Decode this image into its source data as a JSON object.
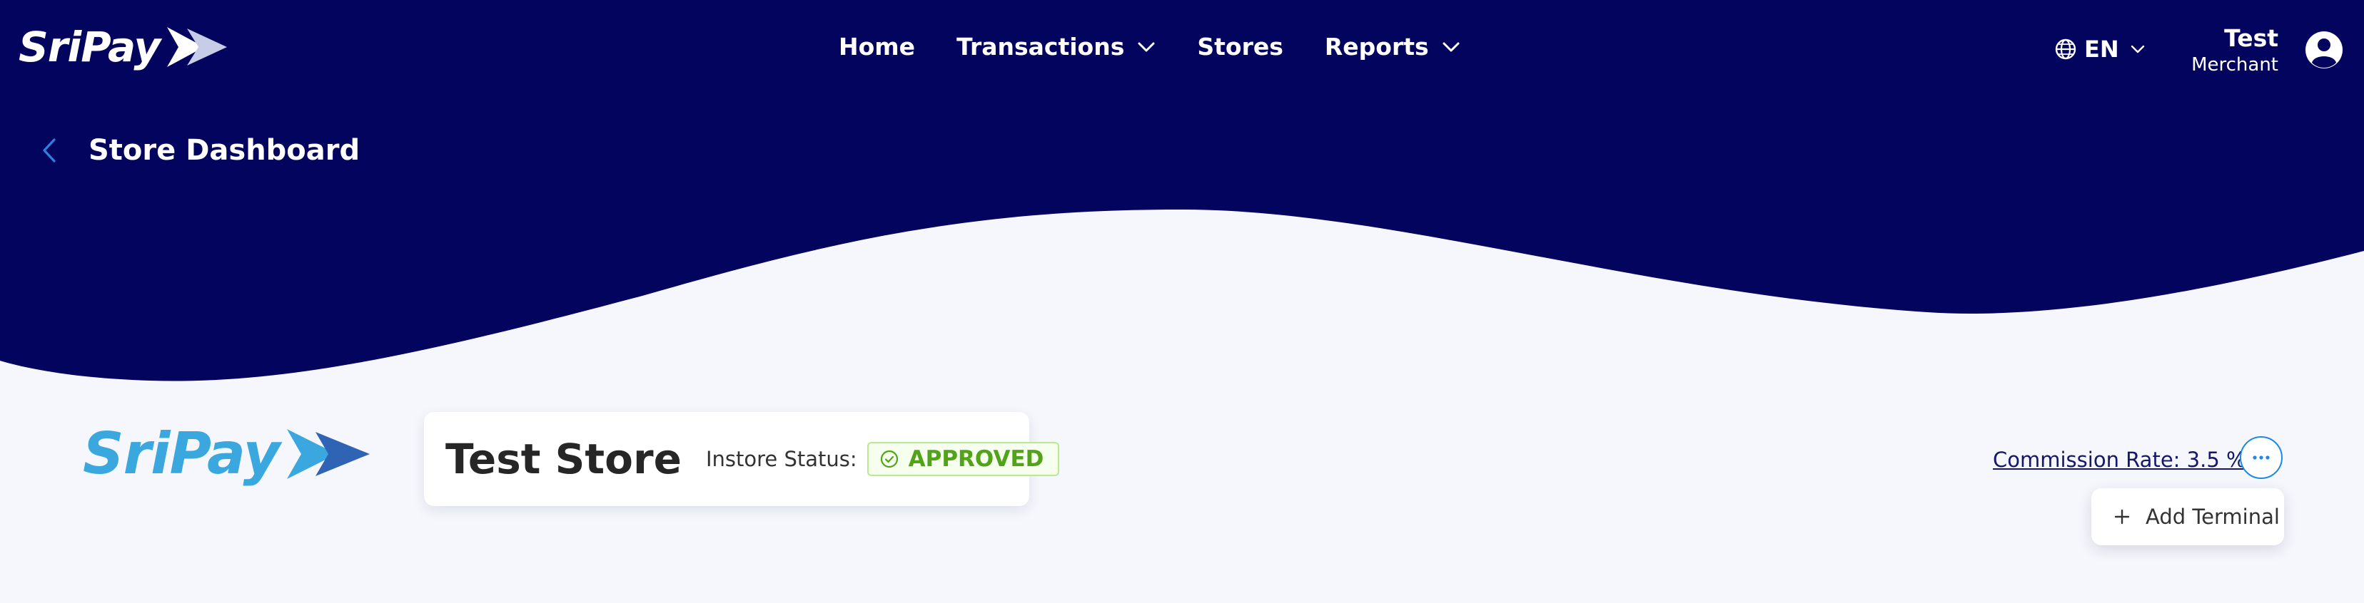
{
  "brand": {
    "name": "SriPay"
  },
  "nav": {
    "items": [
      {
        "label": "Home",
        "has_dropdown": false
      },
      {
        "label": "Transactions",
        "has_dropdown": true
      },
      {
        "label": "Stores",
        "has_dropdown": false
      },
      {
        "label": "Reports",
        "has_dropdown": true
      }
    ]
  },
  "language": {
    "label": "EN",
    "icon": "globe-icon"
  },
  "user": {
    "name": "Test",
    "role": "Merchant",
    "icon": "user-avatar-icon"
  },
  "page": {
    "title": "Store Dashboard",
    "back_icon": "chevron-left-icon"
  },
  "store": {
    "logo_name": "SriPay",
    "name": "Test Store",
    "status_label": "Instore Status:",
    "status_value": "APPROVED",
    "status_icon": "check-circle-icon",
    "commission": "Commission Rate: 3.5 %"
  },
  "actions": {
    "more_icon": "ellipsis-icon",
    "menu": [
      {
        "label": "Add Terminal",
        "icon": "plus-icon"
      }
    ]
  },
  "colors": {
    "header_bg": "#03045e",
    "page_bg": "#f6f7fd",
    "accent": "#1e88e5",
    "approved_green": "#52a31a",
    "logo_blue": "#3aa8df",
    "link_navy": "#15176b"
  }
}
